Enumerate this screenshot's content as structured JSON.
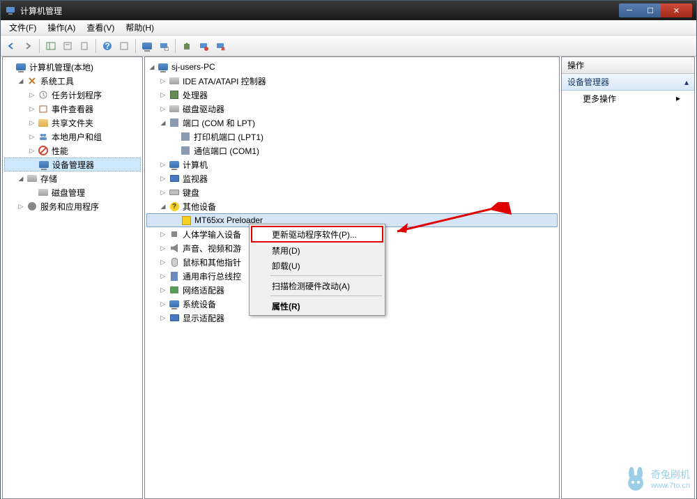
{
  "window": {
    "title": "计算机管理"
  },
  "menubar": {
    "file": "文件(F)",
    "action": "操作(A)",
    "view": "查看(V)",
    "help": "帮助(H)"
  },
  "left_tree": {
    "root": "计算机管理(本地)",
    "system_tools": "系统工具",
    "task_scheduler": "任务计划程序",
    "event_viewer": "事件查看器",
    "shared_folders": "共享文件夹",
    "local_users": "本地用户和组",
    "performance": "性能",
    "device_manager": "设备管理器",
    "storage": "存储",
    "disk_management": "磁盘管理",
    "services_apps": "服务和应用程序"
  },
  "mid_tree": {
    "root": "sj-users-PC",
    "ide": "IDE ATA/ATAPI 控制器",
    "processor": "处理器",
    "disk_drives": "磁盘驱动器",
    "ports": "端口 (COM 和 LPT)",
    "printer_port": "打印机端口 (LPT1)",
    "comm_port": "通信端口 (COM1)",
    "computer": "计算机",
    "monitor": "监视器",
    "keyboard": "键盘",
    "other_devices": "其他设备",
    "mt65xx": "MT65xx Preloader",
    "hid": "人体学输入设备",
    "sound": "声音、视频和游",
    "mouse": "鼠标和其他指针",
    "usb": "通用串行总线控",
    "network": "网络适配器",
    "system_devices": "系统设备",
    "display": "显示适配器"
  },
  "context_menu": {
    "update_driver": "更新驱动程序软件(P)...",
    "disable": "禁用(D)",
    "uninstall": "卸载(U)",
    "scan_hardware": "扫描检测硬件改动(A)",
    "properties": "属性(R)"
  },
  "actions_panel": {
    "header": "操作",
    "subheader": "设备管理器",
    "more_actions": "更多操作"
  },
  "watermark": {
    "brand": "奇兔刷机",
    "url": "www.7to.cn"
  }
}
